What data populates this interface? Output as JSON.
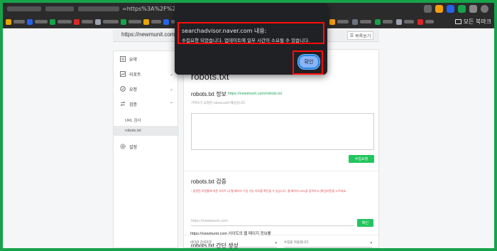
{
  "browser": {
    "url_visible": "=https%3A%2F%2Fnewmunit.com",
    "bookmark_folder": "모든 북마크",
    "colors": {
      "accent_green": "#16a34a"
    }
  },
  "page": {
    "site_url": "https://newmunit.com",
    "list_button": "목록보기",
    "sidebar": {
      "items": [
        {
          "label": "요약",
          "icon": "summary-icon"
        },
        {
          "label": "리포트",
          "icon": "report-icon"
        },
        {
          "label": "요청",
          "icon": "request-icon"
        },
        {
          "label": "검증",
          "icon": "verify-icon"
        }
      ],
      "subitems": [
        {
          "label": "URL 검사"
        },
        {
          "label": "robots.txt"
        }
      ],
      "settings": {
        "label": "설정",
        "icon": "settings-icon"
      }
    },
    "main": {
      "title": "robots.txt",
      "info_title": "robots.txt 정보",
      "info_link": "https://newmunit.com/robots.txt",
      "info_hint": "가져오기 요청된 robots.txt의 예상입니다.",
      "collect_button": "수집요청",
      "verify_title": "robots.txt 검증",
      "verify_warning": "* 잘못된 로봇룰에 따른 사이트 내 웹 페이지 수집 가능 여부를 확인할 수 있습니다. 웹 페이지 URL을 입력하고 [확인]버튼을 누르세요.",
      "verify_placeholder": "https://newmunit.com",
      "verify_button": "확인",
      "gen_title": "robots.txt 간단 생성",
      "gen_desc": "https://newmunit.com 사이트의 웹 페이지 정보를",
      "select1": "네이버 검색로봇",
      "select2": "수집을 허용합니다."
    }
  },
  "modal": {
    "title": "searchadvisor.naver.com 내용:",
    "message": "수집요청 되었습니다. 업데이트에 일부 시간이 소요될 수 있습니다.",
    "ok_button": "확인"
  }
}
